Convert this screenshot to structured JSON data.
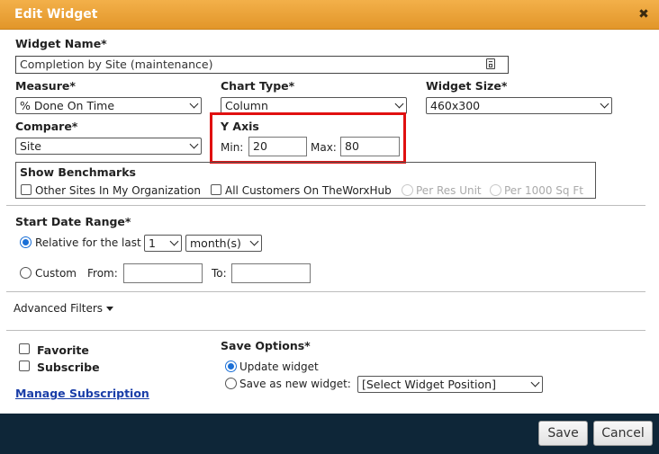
{
  "dialog": {
    "title": "Edit Widget"
  },
  "widget_name": {
    "label": "Widget Name*",
    "value": "Completion by Site (maintenance)"
  },
  "measure": {
    "label": "Measure*",
    "value": "% Done On Time"
  },
  "chart_type": {
    "label": "Chart Type*",
    "value": "Column"
  },
  "widget_size": {
    "label": "Widget Size*",
    "value": "460x300"
  },
  "compare": {
    "label": "Compare*",
    "value": "Site"
  },
  "y_axis": {
    "label": "Y Axis",
    "min_label": "Min:",
    "min_value": "20",
    "max_label": "Max:",
    "max_value": "80"
  },
  "benchmarks": {
    "label": "Show Benchmarks",
    "options": [
      {
        "label": "Other Sites In My Organization"
      },
      {
        "label": "All Customers On TheWorxHub"
      },
      {
        "label": "Per Res Unit"
      },
      {
        "label": "Per 1000 Sq Ft"
      }
    ]
  },
  "date_range": {
    "label": "Start Date Range*",
    "relative_label": "Relative for the last",
    "relative_count": "1",
    "relative_unit": "month(s)",
    "custom_label": "Custom",
    "from_label": "From:",
    "to_label": "To:"
  },
  "advanced_filters": {
    "label": "Advanced Filters"
  },
  "favorite": {
    "label": "Favorite"
  },
  "subscribe": {
    "label": "Subscribe"
  },
  "manage_subscription": {
    "label": "Manage Subscription"
  },
  "save_options": {
    "label": "Save Options*",
    "update_label": "Update widget",
    "save_new_label": "Save as new widget:",
    "position_value": "[Select Widget Position]"
  },
  "footer": {
    "save_label": "Save",
    "cancel_label": "Cancel"
  },
  "colors": {
    "header": "#e8a035",
    "footer": "#0e2638",
    "highlight": "#e01010",
    "link": "#1a3ea8",
    "radio_selected": "#1a6fd6"
  },
  "icons": {
    "close": "close-icon",
    "field_helper": "clipboard-icon",
    "dropdown": "chevron-down-icon"
  }
}
